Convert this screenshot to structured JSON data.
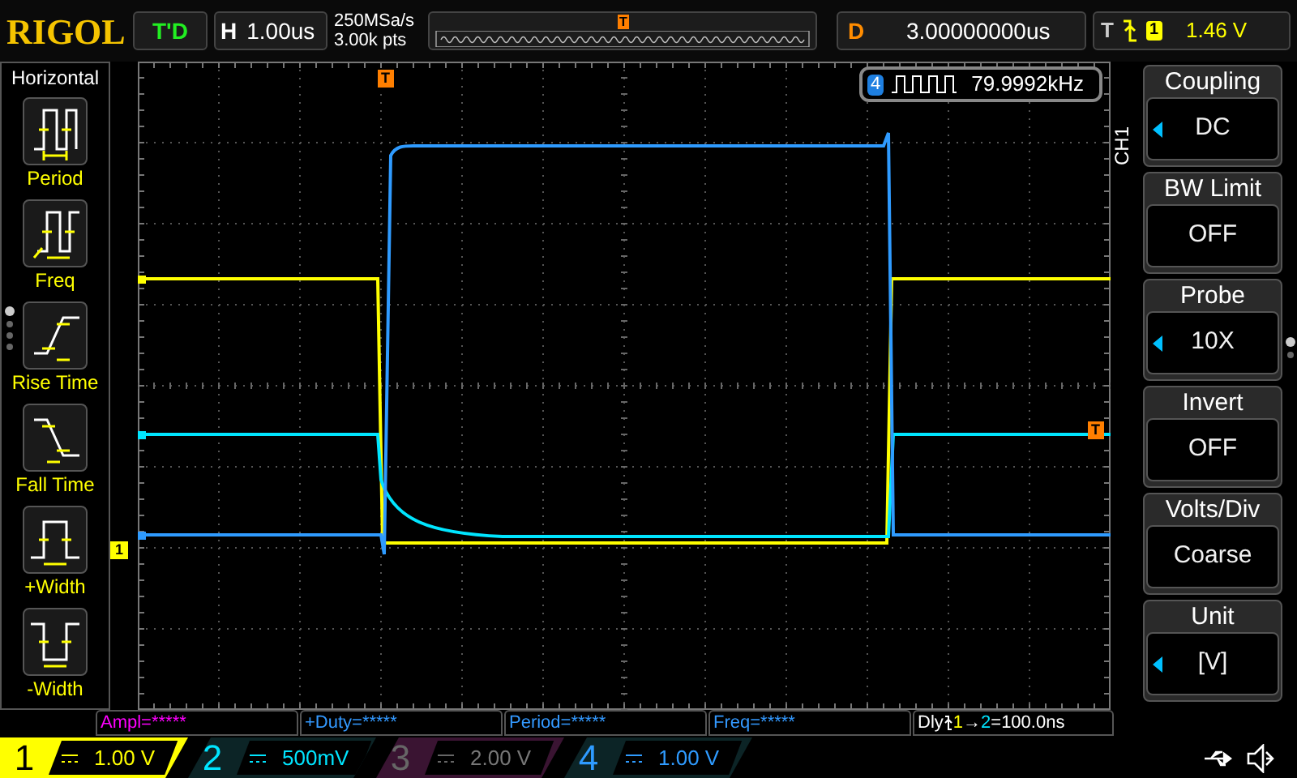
{
  "brand": "RIGOL",
  "run_status": "T'D",
  "timebase": {
    "label": "H",
    "value": "1.00us"
  },
  "sample_rate": "250MSa/s",
  "memory_depth": "3.00k pts",
  "overview_marker": "T",
  "delay": {
    "label": "D",
    "value": "3.00000000us"
  },
  "trigger": {
    "label": "T",
    "channel": "1",
    "level": "1.46 V"
  },
  "left_menu": {
    "title": "Horizontal",
    "items": [
      {
        "label": "Period",
        "kind": "period"
      },
      {
        "label": "Freq",
        "kind": "freq"
      },
      {
        "label": "Rise Time",
        "kind": "rise"
      },
      {
        "label": "Fall Time",
        "kind": "fall"
      },
      {
        "label": "+Width",
        "kind": "pwidth"
      },
      {
        "label": "-Width",
        "kind": "nwidth"
      }
    ],
    "pages": [
      {
        "selected": true
      },
      {
        "selected": false
      },
      {
        "selected": false
      },
      {
        "selected": false
      }
    ]
  },
  "channel_offset_marker": "1",
  "trigger_position_marker": "T",
  "trigger_level_marker": "T",
  "counter": {
    "channel": "4",
    "value": "79.9992kHz"
  },
  "right_menu": {
    "channel": "CH1",
    "items": [
      {
        "title": "Coupling",
        "value": "DC",
        "adjustable": true
      },
      {
        "title": "BW Limit",
        "value": "OFF",
        "adjustable": false
      },
      {
        "title": "Probe",
        "value": "10X",
        "adjustable": true
      },
      {
        "title": "Invert",
        "value": "OFF",
        "adjustable": false
      },
      {
        "title": "Volts/Div",
        "value": "Coarse",
        "adjustable": false
      },
      {
        "title": "Unit",
        "value": "[V]",
        "adjustable": true
      }
    ],
    "pages": [
      {
        "selected": true
      },
      {
        "selected": false
      }
    ]
  },
  "measurements": [
    {
      "text": "Ampl=*****",
      "color": "#ff00ff"
    },
    {
      "text": "+Duty=*****",
      "color": "#3399ff"
    },
    {
      "text": "Period=*****",
      "color": "#3399ff"
    },
    {
      "text": "Freq=*****",
      "color": "#3399ff"
    }
  ],
  "delay_measure": {
    "label": "Dly",
    "from": "1",
    "arrow": "→",
    "to": "2",
    "value": "=100.0ns"
  },
  "channels": [
    {
      "number": "1",
      "scale": "1.00 V",
      "color": "#ffff00",
      "enabled": true,
      "selected": true
    },
    {
      "number": "2",
      "scale": "500mV",
      "color": "#00e5ff",
      "enabled": true,
      "selected": false
    },
    {
      "number": "3",
      "scale": "2.00 V",
      "color": "#3a1432",
      "enabled": false,
      "selected": false
    },
    {
      "number": "4",
      "scale": "1.00 V",
      "color": "#2f9bff",
      "enabled": true,
      "selected": false
    }
  ]
}
